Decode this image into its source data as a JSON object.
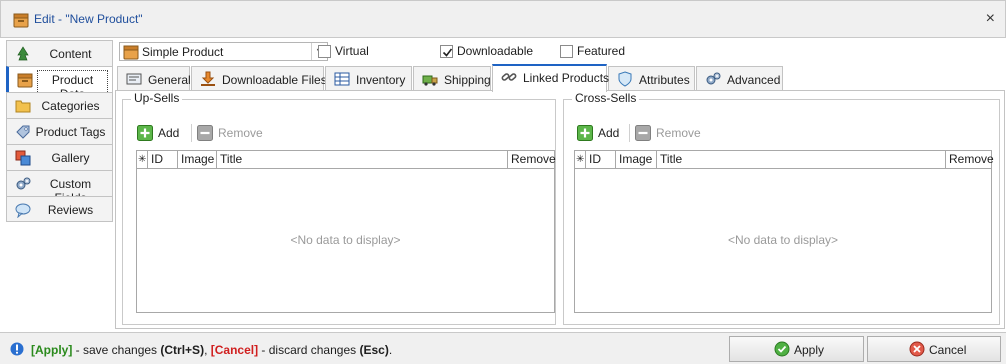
{
  "window": {
    "title": "Edit - \"New Product\"",
    "close_label": "×"
  },
  "sidebar": {
    "items": [
      {
        "label": "Content"
      },
      {
        "label": "Product Data"
      },
      {
        "label": "Categories"
      },
      {
        "label": "Product Tags"
      },
      {
        "label": "Gallery"
      },
      {
        "label": "Custom Fields"
      },
      {
        "label": "Reviews"
      }
    ],
    "active": "Product Data"
  },
  "product_type": {
    "value": "Simple Product"
  },
  "options": {
    "virtual": {
      "label": "Virtual",
      "checked": false
    },
    "downloadable": {
      "label": "Downloadable",
      "checked": true
    },
    "featured": {
      "label": "Featured",
      "checked": false
    }
  },
  "tabs": [
    {
      "label": "General"
    },
    {
      "label": "Downloadable Files"
    },
    {
      "label": "Inventory"
    },
    {
      "label": "Shipping"
    },
    {
      "label": "Linked Products"
    },
    {
      "label": "Attributes"
    },
    {
      "label": "Advanced"
    }
  ],
  "active_tab": "Linked Products",
  "upsells": {
    "title": "Up-Sells",
    "add_label": "Add",
    "remove_label": "Remove",
    "columns": [
      "ID",
      "Image",
      "Title",
      "Remove"
    ],
    "empty_text": "<No data to display>"
  },
  "crosssells": {
    "title": "Cross-Sells",
    "add_label": "Add",
    "remove_label": "Remove",
    "columns": [
      "ID",
      "Image",
      "Title",
      "Remove"
    ],
    "empty_text": "<No data to display>"
  },
  "status": {
    "apply_key": "[Apply]",
    "apply_text": " - save changes ",
    "apply_shortcut": "(Ctrl+S)",
    "comma": ", ",
    "cancel_key": "[Cancel]",
    "cancel_text": " - discard changes ",
    "cancel_shortcut": "(Esc)",
    "period": "."
  },
  "buttons": {
    "apply_label": "Apply",
    "cancel_label": "Cancel"
  },
  "colors": {
    "accent": "#1e63c4",
    "apply": "#2a8a1c",
    "cancel": "#d01f1f",
    "title": "#1f4e9c"
  }
}
